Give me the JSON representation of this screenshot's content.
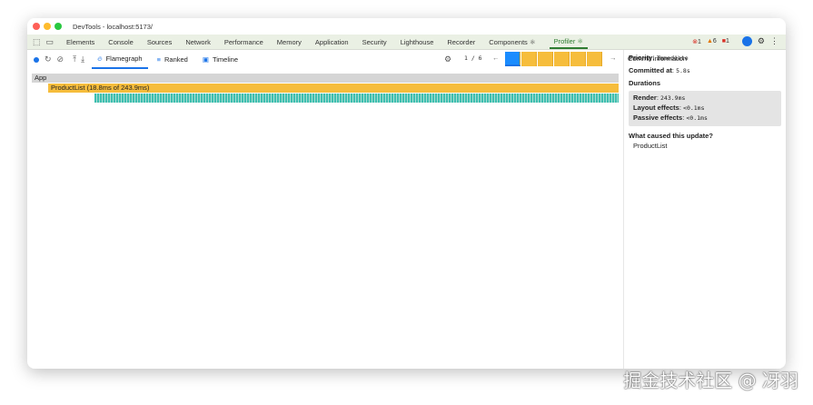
{
  "window": {
    "title": "DevTools - localhost:5173/"
  },
  "tabs": [
    "Elements",
    "Console",
    "Sources",
    "Network",
    "Performance",
    "Memory",
    "Application",
    "Security",
    "Lighthouse",
    "Recorder",
    "Components ⚛",
    "Profiler ⚛"
  ],
  "status": {
    "errors": "1",
    "warnings": "6",
    "issues": "1"
  },
  "profiler": {
    "tabs": [
      "Flamegraph",
      "Ranked",
      "Timeline"
    ],
    "commit_index": "1",
    "commit_total": "6",
    "commit_label": "1 / 6"
  },
  "flame": {
    "root": "App",
    "child": "ProductList (18.8ms of 243.9ms)"
  },
  "side": {
    "header": "Commit information",
    "priority_label": "Priority",
    "priority": "Immediate",
    "committed_label": "Committed at",
    "committed": "5.8s",
    "durations": "Durations",
    "render_label": "Render",
    "render": "243.9ms",
    "layout_label": "Layout effects",
    "layout": "<0.1ms",
    "passive_label": "Passive effects",
    "passive": "<0.1ms",
    "cause_label": "What caused this update?",
    "cause": "ProductList"
  },
  "watermark": "掘金技术社区 @ 冴羽",
  "colors": {
    "accent": "#1a73e8",
    "flame_yellow": "#f6bd3c",
    "flame_teal": "#3fbfb0"
  }
}
